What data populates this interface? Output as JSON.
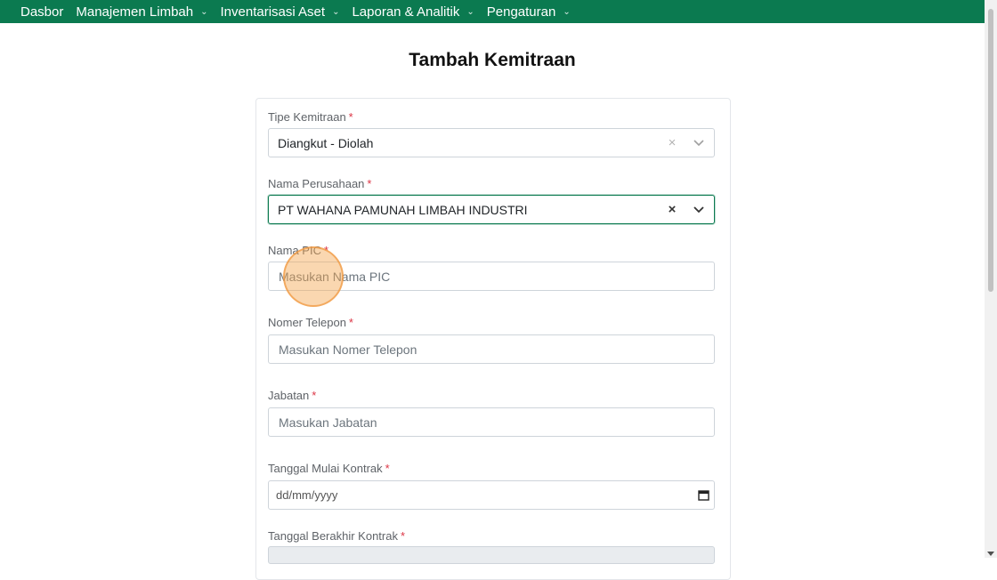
{
  "navbar": {
    "items": [
      {
        "label": "Dasbor",
        "has_dropdown": false
      },
      {
        "label": "Manajemen Limbah",
        "has_dropdown": true
      },
      {
        "label": "Inventarisasi Aset",
        "has_dropdown": true
      },
      {
        "label": "Laporan & Analitik",
        "has_dropdown": true
      },
      {
        "label": "Pengaturan",
        "has_dropdown": true
      }
    ],
    "color": "#0b7a50"
  },
  "page": {
    "title": "Tambah Kemitraan"
  },
  "form": {
    "required_marker": "*",
    "tipe_kemitraan": {
      "label": "Tipe Kemitraan",
      "value": "Diangkut - Diolah"
    },
    "nama_perusahaan": {
      "label": "Nama Perusahaan",
      "value": "PT WAHANA PAMUNAH LIMBAH INDUSTRI"
    },
    "nama_pic": {
      "label": "Nama PIC",
      "placeholder": "Masukan Nama PIC"
    },
    "nomer_telepon": {
      "label": "Nomer Telepon",
      "placeholder": "Masukan Nomer Telepon"
    },
    "jabatan": {
      "label": "Jabatan",
      "placeholder": "Masukan Jabatan"
    },
    "tanggal_mulai": {
      "label": "Tanggal Mulai Kontrak",
      "placeholder": "dd/mm/yyyy"
    },
    "tanggal_berakhir": {
      "label": "Tanggal Berakhir Kontrak"
    }
  },
  "icons": {
    "clear": "×",
    "dropdown": "chevron-down-icon",
    "calendar": "calendar-icon"
  }
}
